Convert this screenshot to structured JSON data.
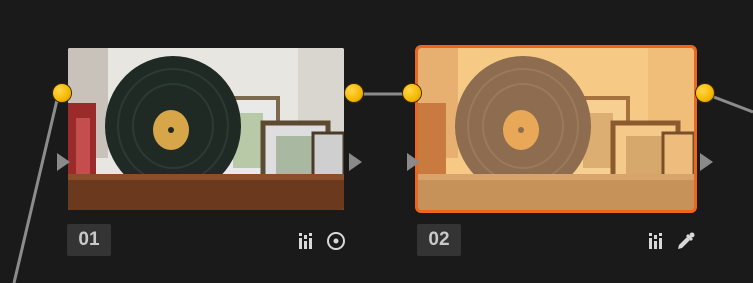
{
  "nodes": [
    {
      "number": "01",
      "tools": [
        "histogram-icon",
        "circle-target-icon"
      ],
      "selected": false
    },
    {
      "number": "02",
      "tools": [
        "histogram-icon",
        "eyedropper-icon"
      ],
      "selected": true
    }
  ],
  "colors": {
    "background": "#1a1a1a",
    "selected_outline": "#e9671e",
    "input_dot": "#f5b800",
    "connection_line": "#8c8c8c"
  }
}
